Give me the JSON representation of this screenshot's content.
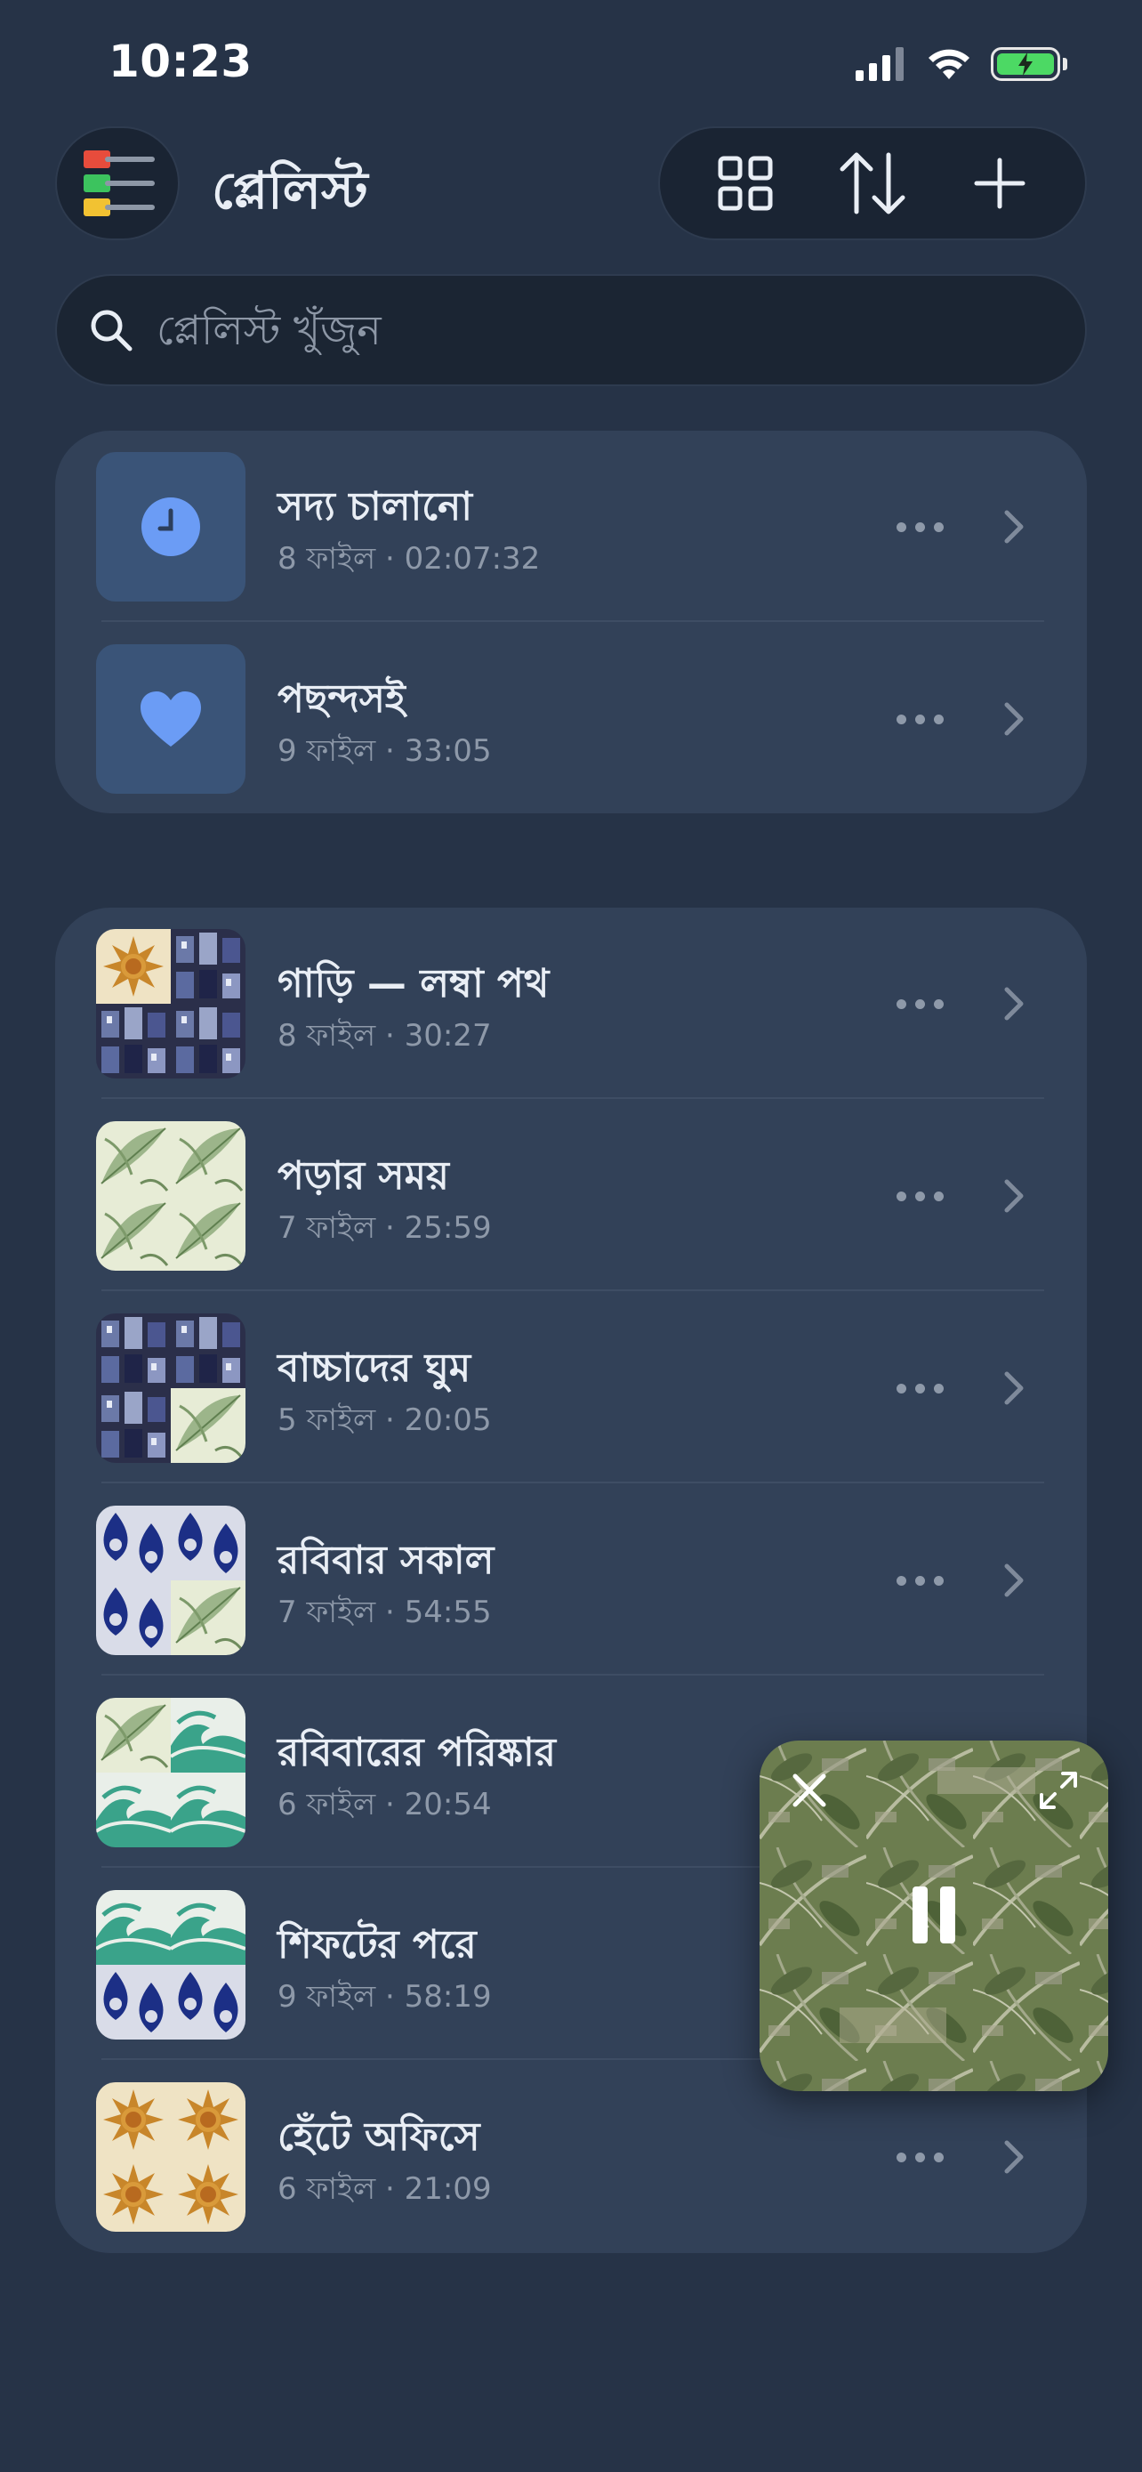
{
  "status_bar": {
    "time": "10:23"
  },
  "header": {
    "title": "প্লেলিস্ট",
    "icons": [
      "menu-icon",
      "grid-view-icon",
      "sort-icon",
      "add-icon"
    ]
  },
  "search": {
    "placeholder": "প্লেলিস্ট খুঁজুন"
  },
  "pinned": [
    {
      "title": "সদ্য চালানো",
      "subtitle": "8 ফাইল · 02:07:32",
      "icon": "clock-icon"
    },
    {
      "title": "পছন্দসই",
      "subtitle": "9 ফাইল · 33:05",
      "icon": "heart-icon"
    }
  ],
  "playlists": [
    {
      "title": "গাড়ি — লম্বা পথ",
      "subtitle": "8 ফাইল · 30:27"
    },
    {
      "title": "পড়ার সময়",
      "subtitle": "7 ফাইল · 25:59"
    },
    {
      "title": "বাচ্চাদের ঘুম",
      "subtitle": "5 ফাইল · 20:05"
    },
    {
      "title": "রবিবার সকাল",
      "subtitle": "7 ফাইল · 54:55"
    },
    {
      "title": "রবিবারের পরিষ্কার",
      "subtitle": "6 ফাইল · 20:54"
    },
    {
      "title": "শিফটের পরে",
      "subtitle": "9 ফাইল · 58:19"
    },
    {
      "title": "হেঁটে অফিসে",
      "subtitle": "6 ফাইল · 21:09"
    }
  ],
  "mini_player": {
    "state": "playing",
    "icons": [
      "close-icon",
      "expand-icon",
      "pause-icon"
    ]
  },
  "colors": {
    "background": "#263347",
    "card": "#324158",
    "accent": "#5b8def",
    "battery": "#4cd964"
  }
}
